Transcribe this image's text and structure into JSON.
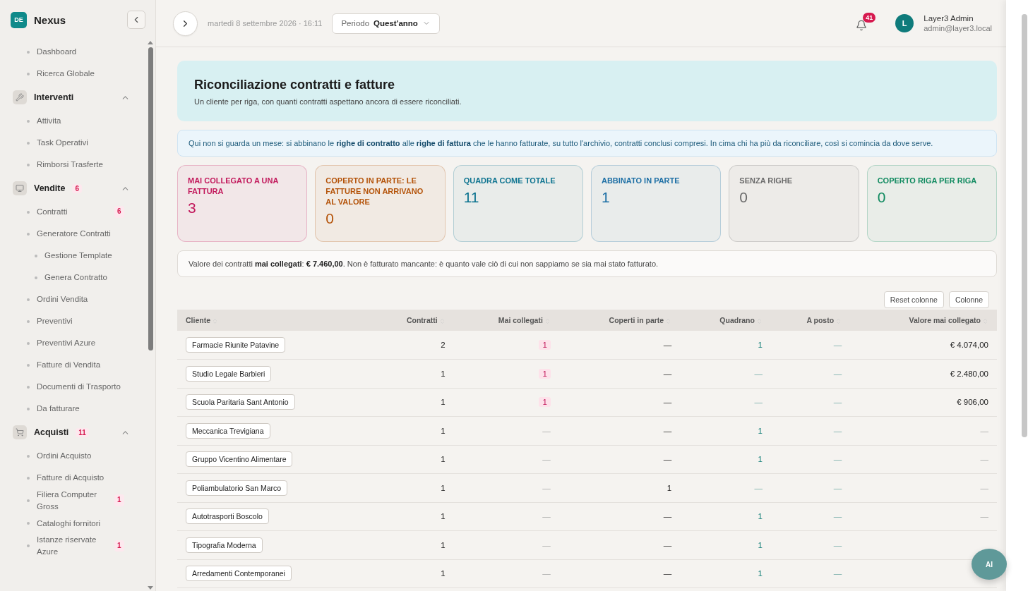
{
  "brand": {
    "badge": "DE",
    "name": "Nexus"
  },
  "sidebar": {
    "items": [
      {
        "kind": "link",
        "label": "Dashboard"
      },
      {
        "kind": "link",
        "label": "Ricerca Globale"
      },
      {
        "kind": "section",
        "label": "Interventi",
        "expanded": true,
        "children": [
          {
            "kind": "link",
            "label": "Attivita"
          },
          {
            "kind": "link",
            "label": "Task Operativi"
          },
          {
            "kind": "link",
            "label": "Rimborsi Trasferte"
          }
        ]
      },
      {
        "kind": "section",
        "label": "Vendite",
        "badge": "6",
        "expanded": true,
        "children": [
          {
            "kind": "link",
            "label": "Contratti",
            "badge": "6"
          },
          {
            "kind": "link",
            "label": "Generatore Contratti",
            "children": [
              {
                "kind": "link",
                "label": "Gestione Template"
              },
              {
                "kind": "link",
                "label": "Genera Contratto"
              }
            ]
          },
          {
            "kind": "link",
            "label": "Ordini Vendita"
          },
          {
            "kind": "link",
            "label": "Preventivi"
          },
          {
            "kind": "link",
            "label": "Preventivi Azure"
          },
          {
            "kind": "link",
            "label": "Fatture di Vendita"
          },
          {
            "kind": "link",
            "label": "Documenti di Trasporto"
          },
          {
            "kind": "link",
            "label": "Da fatturare"
          }
        ]
      },
      {
        "kind": "section",
        "label": "Acquisti",
        "badge": "11",
        "expanded": true,
        "children": [
          {
            "kind": "link",
            "label": "Ordini Acquisto"
          },
          {
            "kind": "link",
            "label": "Fatture di Acquisto"
          },
          {
            "kind": "link",
            "label": "Filiera Computer Gross",
            "badge": "1"
          },
          {
            "kind": "link",
            "label": "Cataloghi fornitori"
          },
          {
            "kind": "link",
            "label": "Istanze riservate Azure",
            "badge": "1"
          }
        ]
      }
    ]
  },
  "header": {
    "date": "martedì 8 settembre 2026 · 16:11",
    "period_label": "Periodo",
    "period_value": "Quest'anno",
    "notifications": "41",
    "user": {
      "initial": "L",
      "name": "Layer3 Admin",
      "email": "admin@layer3.local"
    }
  },
  "hero": {
    "title": "Riconciliazione contratti e fatture",
    "subtitle": "Un cliente per riga, con quanti contratti aspettano ancora di essere riconciliati."
  },
  "info": "Qui non si guarda un mese: si abbinano le **righe di contratto** alle **righe di fattura** che le hanno fatturate, su tutto l'archivio, contratti conclusi compresi. In cima chi ha più da riconciliare, così si comincia da dove serve.",
  "stats": [
    {
      "label": "MAI COLLEGATO A UNA FATTURA",
      "value": "3",
      "color": "#c2185b"
    },
    {
      "label": "COPERTO IN PARTE: LE FATTURE NON ARRIVANO AL VALORE",
      "value": "0",
      "color": "#b45309"
    },
    {
      "label": "QUADRA COME TOTALE",
      "value": "11",
      "color": "#0e7490"
    },
    {
      "label": "ABBINATO IN PARTE",
      "value": "1",
      "color": "#1d6fa5"
    },
    {
      "label": "SENZA RIGHE",
      "value": "0",
      "color": "#6b6b6b"
    },
    {
      "label": "COPERTO RIGA PER RIGA",
      "value": "0",
      "color": "#0f8a5f"
    }
  ],
  "note": "Valore dei contratti **mai collegati**: **€ 7.460,00**. Non è fatturato mancante: è quanto vale ciò di cui non sappiamo se sia mai stato fatturato.",
  "table_buttons": [
    "Reset colonne",
    "Colonne"
  ],
  "table": {
    "columns": [
      "Cliente",
      "Contratti",
      "Mai collegati",
      "Coperti in parte",
      "Quadrano",
      "A posto",
      "Valore mai collegato"
    ],
    "rows": [
      {
        "cells": [
          {
            "text": "Farmacie Riunite Patavine",
            "kind": "client"
          },
          {
            "text": "2",
            "kind": "plain"
          },
          {
            "text": "1",
            "kind": "badge"
          },
          {
            "text": "—",
            "kind": "plain"
          },
          {
            "text": "1",
            "kind": "accent"
          },
          {
            "text": "—",
            "kind": "accent-dim"
          },
          {
            "text": "€ 4.074,00",
            "kind": "plain"
          }
        ]
      },
      {
        "cells": [
          {
            "text": "Studio Legale Barbieri",
            "kind": "client"
          },
          {
            "text": "1",
            "kind": "plain"
          },
          {
            "text": "1",
            "kind": "badge"
          },
          {
            "text": "—",
            "kind": "plain"
          },
          {
            "text": "—",
            "kind": "accent-dim"
          },
          {
            "text": "—",
            "kind": "accent-dim"
          },
          {
            "text": "€ 2.480,00",
            "kind": "plain"
          }
        ]
      },
      {
        "cells": [
          {
            "text": "Scuola Paritaria Sant Antonio",
            "kind": "client"
          },
          {
            "text": "1",
            "kind": "plain"
          },
          {
            "text": "1",
            "kind": "badge"
          },
          {
            "text": "—",
            "kind": "plain"
          },
          {
            "text": "—",
            "kind": "accent-dim"
          },
          {
            "text": "—",
            "kind": "accent-dim"
          },
          {
            "text": "€ 906,00",
            "kind": "plain"
          }
        ]
      },
      {
        "cells": [
          {
            "text": "Meccanica Trevigiana",
            "kind": "client"
          },
          {
            "text": "1",
            "kind": "plain"
          },
          {
            "text": "—",
            "kind": "muted"
          },
          {
            "text": "—",
            "kind": "plain"
          },
          {
            "text": "1",
            "kind": "accent"
          },
          {
            "text": "—",
            "kind": "accent-dim"
          },
          {
            "text": "—",
            "kind": "muted"
          }
        ]
      },
      {
        "cells": [
          {
            "text": "Gruppo Vicentino Alimentare",
            "kind": "client"
          },
          {
            "text": "1",
            "kind": "plain"
          },
          {
            "text": "—",
            "kind": "muted"
          },
          {
            "text": "—",
            "kind": "plain"
          },
          {
            "text": "1",
            "kind": "accent"
          },
          {
            "text": "—",
            "kind": "accent-dim"
          },
          {
            "text": "—",
            "kind": "muted"
          }
        ]
      },
      {
        "cells": [
          {
            "text": "Poliambulatorio San Marco",
            "kind": "client"
          },
          {
            "text": "1",
            "kind": "plain"
          },
          {
            "text": "—",
            "kind": "muted"
          },
          {
            "text": "1",
            "kind": "plain"
          },
          {
            "text": "—",
            "kind": "accent-dim"
          },
          {
            "text": "—",
            "kind": "accent-dim"
          },
          {
            "text": "—",
            "kind": "muted"
          }
        ]
      },
      {
        "cells": [
          {
            "text": "Autotrasporti Boscolo",
            "kind": "client"
          },
          {
            "text": "1",
            "kind": "plain"
          },
          {
            "text": "—",
            "kind": "muted"
          },
          {
            "text": "—",
            "kind": "plain"
          },
          {
            "text": "1",
            "kind": "accent"
          },
          {
            "text": "—",
            "kind": "accent-dim"
          },
          {
            "text": "—",
            "kind": "muted"
          }
        ]
      },
      {
        "cells": [
          {
            "text": "Tipografia Moderna",
            "kind": "client"
          },
          {
            "text": "1",
            "kind": "plain"
          },
          {
            "text": "—",
            "kind": "muted"
          },
          {
            "text": "—",
            "kind": "plain"
          },
          {
            "text": "1",
            "kind": "accent"
          },
          {
            "text": "—",
            "kind": "accent-dim"
          }
        ]
      },
      {
        "cells": [
          {
            "text": "Arredamenti Contemporanei",
            "kind": "client"
          },
          {
            "text": "1",
            "kind": "plain"
          },
          {
            "text": "—",
            "kind": "muted"
          },
          {
            "text": "—",
            "kind": "plain"
          },
          {
            "text": "1",
            "kind": "accent"
          },
          {
            "text": "—",
            "kind": "accent-dim"
          }
        ]
      }
    ]
  },
  "assistant_button": "AI"
}
